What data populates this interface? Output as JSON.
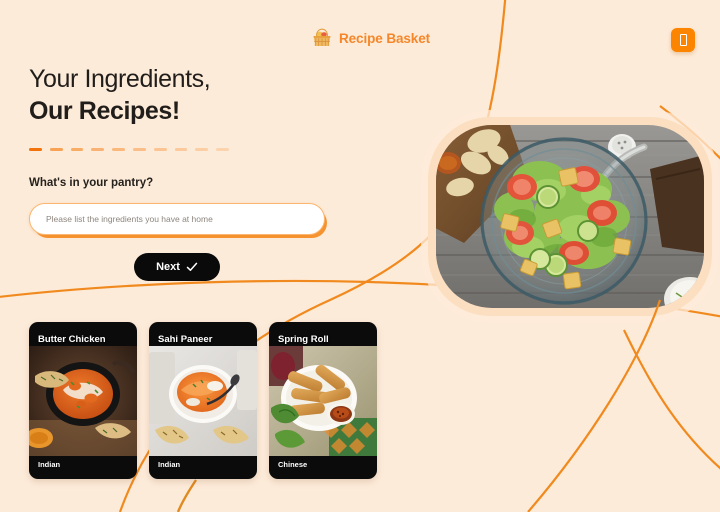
{
  "page": {
    "background_color": "#FDEBD9",
    "accent_color": "#F5872A",
    "accent_strong": "#FB8500",
    "dark_color": "#0A0A0A"
  },
  "header": {
    "logo_icon": "basket-icon",
    "brand": "Recipe Basket",
    "menu_icon": "menu-glyph-icon"
  },
  "hero": {
    "headline_line1": "Your Ingredients,",
    "headline_line2": "Our Recipes!",
    "divider_dashes": 10,
    "image_alt": "salad-bowl-photo"
  },
  "form": {
    "label": "What's in your pantry?",
    "placeholder": "Please list the ingredients you have at home",
    "value": "",
    "submit_label": "Next",
    "submit_icon": "check-icon"
  },
  "recipes": [
    {
      "title": "Butter Chicken",
      "cuisine": "Indian",
      "image_alt": "butter-chicken-photo"
    },
    {
      "title": "Sahi Paneer",
      "cuisine": "Indian",
      "image_alt": "sahi-paneer-photo"
    },
    {
      "title": "Spring Roll",
      "cuisine": "Chinese",
      "image_alt": "spring-roll-photo"
    }
  ]
}
